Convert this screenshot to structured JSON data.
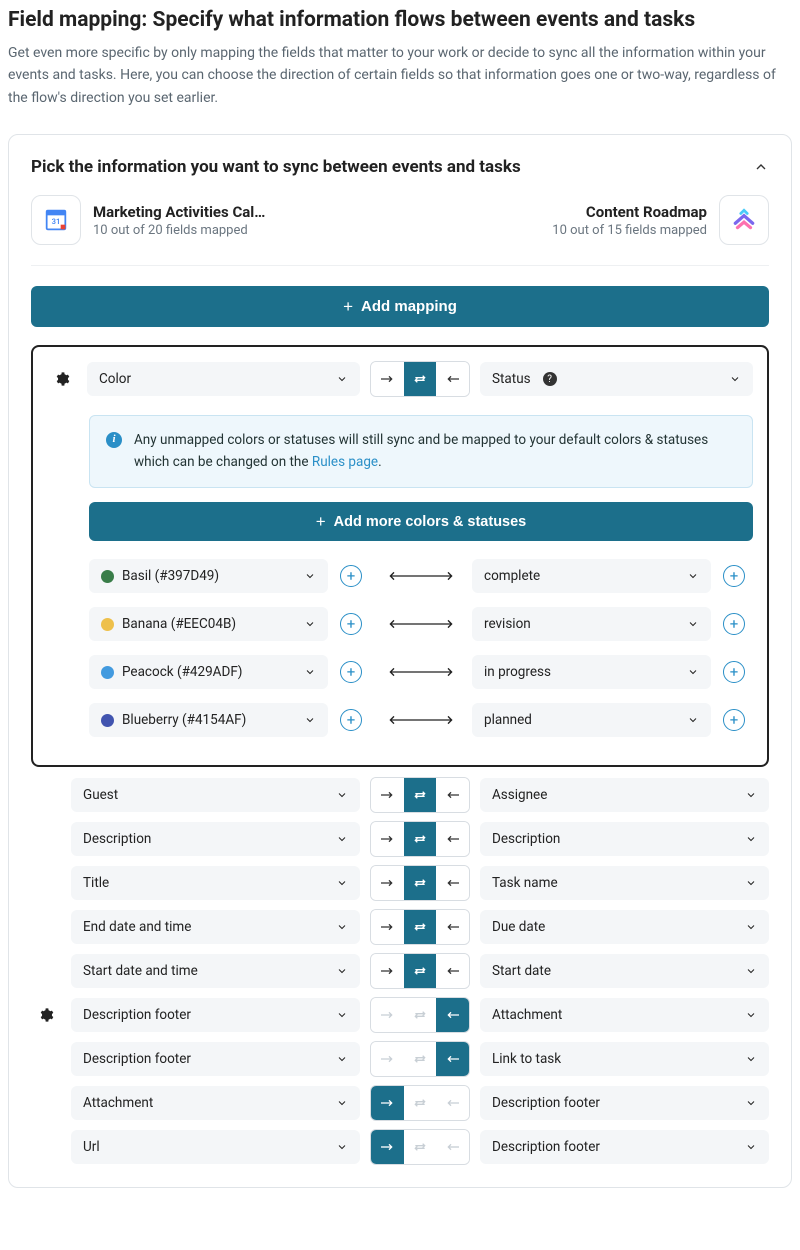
{
  "page": {
    "title": "Field mapping: Specify what information flows between events and tasks",
    "subtitle": "Get even more specific by only mapping the fields that matter to your work or decide to sync all the information within your events and tasks. Here, you can choose the direction of certain fields so that information goes one or two-way, regardless of the flow's direction you set earlier."
  },
  "card": {
    "title": "Pick the information you want to sync between events and tasks"
  },
  "sources": {
    "left": {
      "name": "Marketing Activities Cal…",
      "sub": "10 out of 20 fields mapped"
    },
    "right": {
      "name": "Content Roadmap",
      "sub": "10 out of 15 fields mapped"
    }
  },
  "buttons": {
    "add_mapping": "Add mapping",
    "add_colors": "Add more colors & statuses"
  },
  "top_mapping": {
    "left": "Color",
    "right": "Status"
  },
  "info": {
    "text_pre": "Any unmapped colors or statuses will still sync and be mapped to your default colors & statuses which can be changed on the ",
    "link": "Rules page",
    "text_post": "."
  },
  "color_mappings": [
    {
      "color": "#397D49",
      "left": "Basil (#397D49)",
      "right": "complete"
    },
    {
      "color": "#EEC04B",
      "left": "Banana (#EEC04B)",
      "right": "revision"
    },
    {
      "color": "#429ADF",
      "left": "Peacock (#429ADF)",
      "right": "in progress"
    },
    {
      "color": "#4154AF",
      "left": "Blueberry (#4154AF)",
      "right": "planned"
    }
  ],
  "field_rows": [
    {
      "gear": false,
      "left": "Guest",
      "dir": "both",
      "right": "Assignee"
    },
    {
      "gear": false,
      "left": "Description",
      "dir": "both",
      "right": "Description"
    },
    {
      "gear": false,
      "left": "Title",
      "dir": "both",
      "right": "Task name"
    },
    {
      "gear": false,
      "left": "End date and time",
      "dir": "both",
      "right": "Due date"
    },
    {
      "gear": false,
      "left": "Start date and time",
      "dir": "both",
      "right": "Start date"
    },
    {
      "gear": true,
      "left": "Description footer",
      "dir": "from_right",
      "right": "Attachment"
    },
    {
      "gear": false,
      "left": "Description footer",
      "dir": "from_right",
      "right": "Link to task"
    },
    {
      "gear": false,
      "left": "Attachment",
      "dir": "from_left",
      "right": "Description footer"
    },
    {
      "gear": false,
      "left": "Url",
      "dir": "from_left",
      "right": "Description footer"
    }
  ]
}
